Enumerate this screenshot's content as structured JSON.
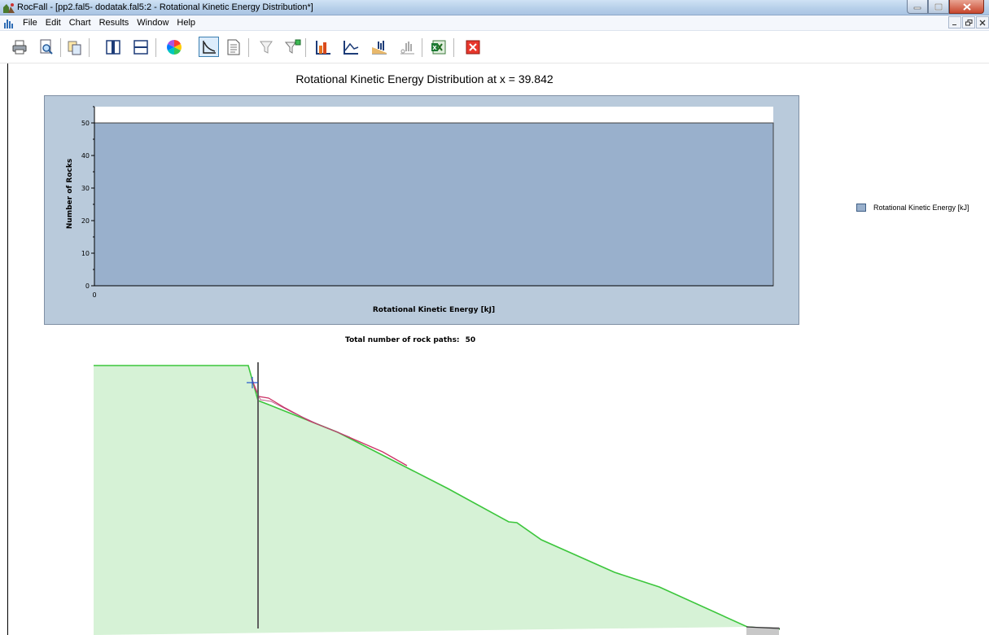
{
  "window": {
    "title": "RocFall - [pp2.fal5- dodatak.fal5:2 - Rotational Kinetic Energy Distribution*]"
  },
  "menu": {
    "items": [
      "File",
      "Edit",
      "Chart",
      "Results",
      "Window",
      "Help"
    ]
  },
  "toolbar": {
    "icons": [
      "print-icon",
      "print-preview-icon",
      "copy-icon",
      "split-vertical-icon",
      "split-horizontal-icon",
      "color-wheel-icon",
      "slope-view-icon",
      "report-icon",
      "filter-icon",
      "filter-settings-icon",
      "histogram-icon",
      "line-graph-icon",
      "cumulative-plot-icon",
      "path-histogram-icon",
      "excel-export-icon",
      "close-view-icon"
    ],
    "active": "slope-view-icon"
  },
  "chart_data": {
    "type": "bar",
    "title": "Rotational Kinetic Energy Distribution at x = 39.842",
    "xlabel": "Rotational Kinetic Energy [kJ]",
    "ylabel": "Number of Rocks",
    "categories": [
      "0"
    ],
    "series": [
      {
        "name": "Rotational Kinetic Energy [kJ]",
        "values": [
          50
        ]
      }
    ],
    "ylim": [
      0,
      55
    ],
    "yticks": [
      0,
      10,
      20,
      30,
      40,
      50
    ],
    "xticks": [
      "0"
    ],
    "legend_position": "right",
    "colors": {
      "bar": "#99b0cc",
      "bar_border": "#404040",
      "panel": "#b9cadb"
    }
  },
  "footer": {
    "total_paths_label": "Total number of rock paths:",
    "total_paths_value": "50"
  },
  "slope": {
    "fill_color": "#d6f2d6",
    "line_color": "#3cc63c",
    "path_color": "#cc3366",
    "collector_color": "#5f5f5f"
  }
}
